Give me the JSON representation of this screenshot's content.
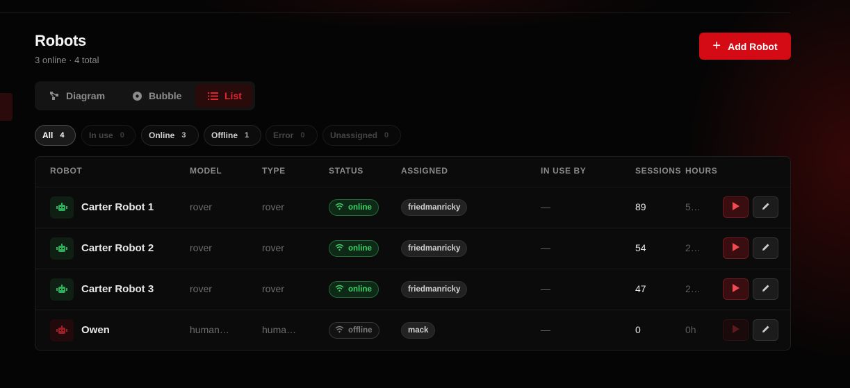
{
  "header": {
    "title": "Robots",
    "subtitle": "3 online · 4 total",
    "add_button_label": "Add Robot"
  },
  "views": {
    "active": "list",
    "items": [
      {
        "id": "diagram",
        "label": "Diagram",
        "icon": "diagram-icon"
      },
      {
        "id": "bubble",
        "label": "Bubble",
        "icon": "bubble-icon"
      },
      {
        "id": "list",
        "label": "List",
        "icon": "list-icon"
      }
    ]
  },
  "filters": [
    {
      "label": "All",
      "count": "4",
      "selected": true,
      "enabled": true
    },
    {
      "label": "In use",
      "count": "0",
      "selected": false,
      "enabled": false
    },
    {
      "label": "Online",
      "count": "3",
      "selected": false,
      "enabled": true
    },
    {
      "label": "Offline",
      "count": "1",
      "selected": false,
      "enabled": true
    },
    {
      "label": "Error",
      "count": "0",
      "selected": false,
      "enabled": false
    },
    {
      "label": "Unassigned",
      "count": "0",
      "selected": false,
      "enabled": false
    }
  ],
  "table": {
    "columns": [
      "ROBOT",
      "MODEL",
      "TYPE",
      "STATUS",
      "ASSIGNED",
      "IN USE BY",
      "SESSIONS",
      "HOURS"
    ],
    "rows": [
      {
        "name": "Carter Robot 1",
        "model": "rover",
        "type": "rover",
        "status": "online",
        "assigned": "friedmanricky",
        "in_use_by": "—",
        "sessions": "89",
        "hours": "5…"
      },
      {
        "name": "Carter Robot 2",
        "model": "rover",
        "type": "rover",
        "status": "online",
        "assigned": "friedmanricky",
        "in_use_by": "—",
        "sessions": "54",
        "hours": "2…"
      },
      {
        "name": "Carter Robot 3",
        "model": "rover",
        "type": "rover",
        "status": "online",
        "assigned": "friedmanricky",
        "in_use_by": "—",
        "sessions": "47",
        "hours": "2…"
      },
      {
        "name": "Owen",
        "model": "human…",
        "type": "huma…",
        "status": "offline",
        "assigned": "mack",
        "in_use_by": "—",
        "sessions": "0",
        "hours": "0h"
      }
    ]
  },
  "colors": {
    "accent": "#d40b14",
    "online": "#3fd26b",
    "offline": "#7d7d7d",
    "background": "#050505"
  }
}
